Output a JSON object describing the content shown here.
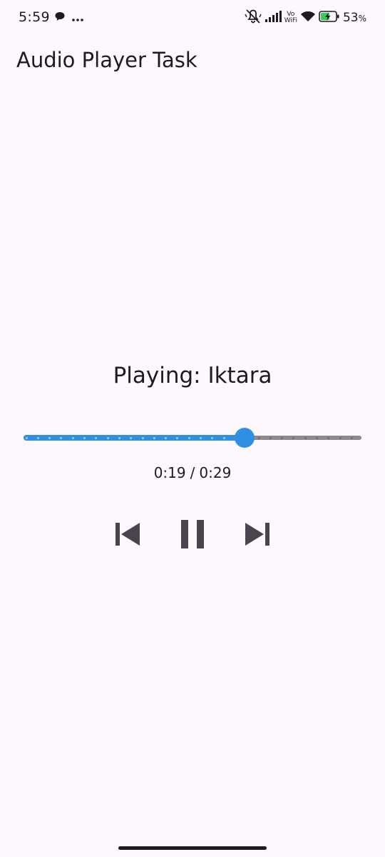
{
  "status_bar": {
    "time": "5:59",
    "battery_value": "53",
    "battery_unit": "%",
    "left_icons": [
      "chat-bubble-icon",
      "more-dots-icon"
    ],
    "right_icons": [
      "vibrate-off-icon",
      "signal-icon",
      "vowifi-icon",
      "wifi-icon",
      "battery-charging-icon"
    ],
    "vowifi_top": "Vo",
    "vowifi_bottom": "WiFi"
  },
  "app": {
    "title": "Audio Player Task"
  },
  "player": {
    "now_playing": "Playing: Iktara",
    "position": "0:19",
    "separator": "/",
    "duration": "0:29",
    "progress_fraction": 0.655,
    "accent_color": "#2f8fe3",
    "track_color": "#8d8a93"
  },
  "controls": {
    "previous_icon": "skip-previous-icon",
    "pause_icon": "pause-icon",
    "next_icon": "skip-next-icon"
  }
}
